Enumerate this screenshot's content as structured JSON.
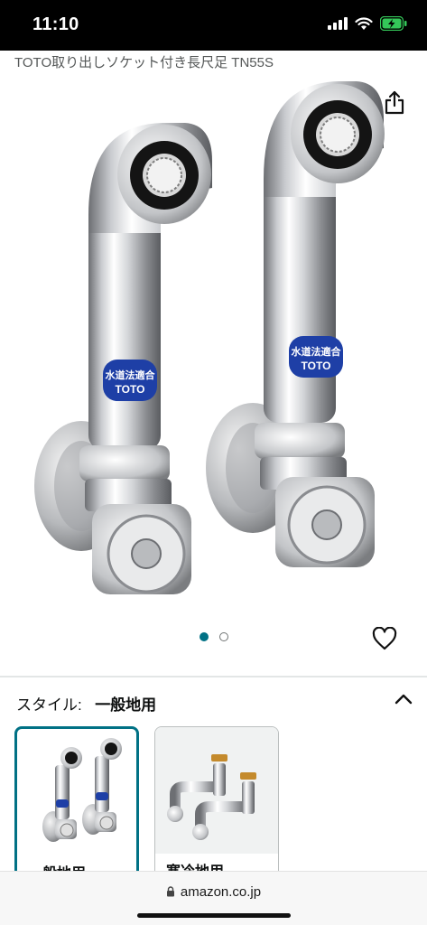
{
  "status_bar": {
    "time": "11:10",
    "icons": [
      "signal-icon",
      "wifi-icon",
      "battery-charging-icon"
    ]
  },
  "product": {
    "title": "TOTO取り出しソケット付き長尺足 TN55S",
    "image_labels": {
      "badge_line1": "水道法適合",
      "badge_line2": "TOTO"
    }
  },
  "gallery": {
    "current_page": 1,
    "total_pages": 2
  },
  "style_selector": {
    "label": "スタイル:",
    "selected_value": "一般地用",
    "expanded": true,
    "options": [
      {
        "label": "一般地用",
        "selected": true
      },
      {
        "label": "寒冷地用",
        "selected": false
      }
    ]
  },
  "browser": {
    "url": "amazon.co.jp"
  },
  "colors": {
    "accent": "#007185",
    "text_primary": "#0f1111",
    "text_secondary": "#565959",
    "battery": "#34c759",
    "badge_blue": "#1e3fa6"
  }
}
